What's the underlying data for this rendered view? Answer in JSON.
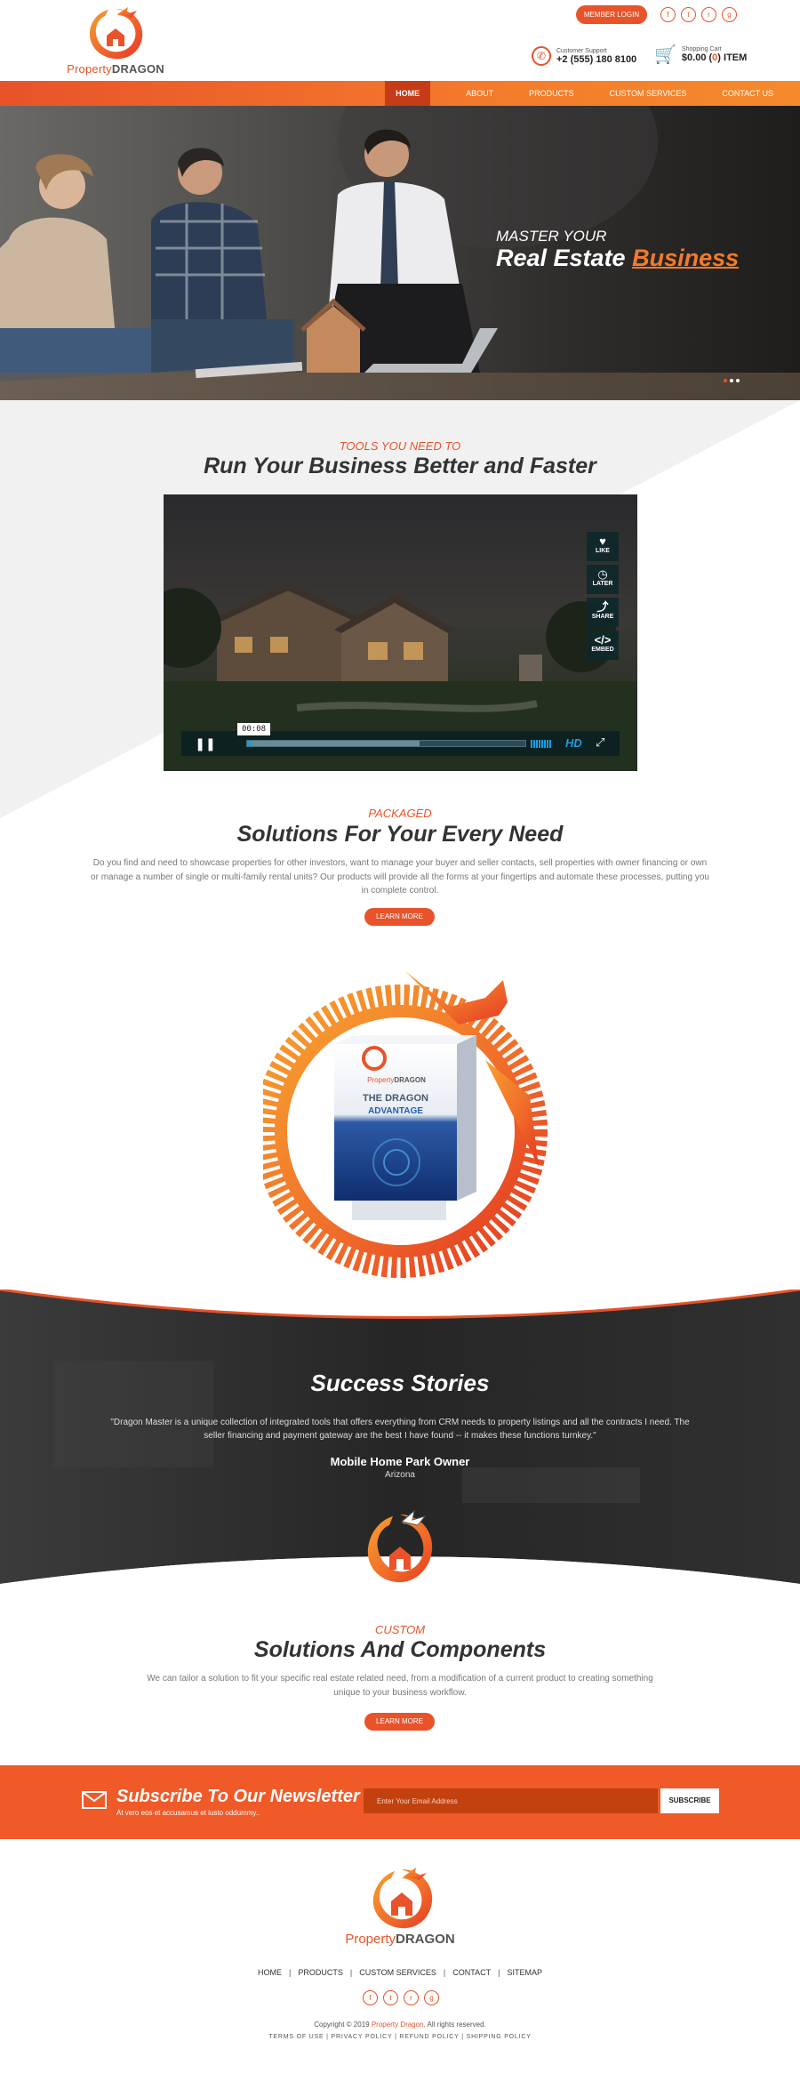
{
  "header": {
    "logo_text_a": "Property",
    "logo_text_b": "DRAGON",
    "member_login": "MEMBER LOGIN",
    "social": [
      "f",
      "t",
      "r",
      "g"
    ],
    "support_label": "Customer Support",
    "support_phone": "+2 (555) 180 8100",
    "cart_label": "Shopping Cart",
    "cart_amount": "$0.00",
    "cart_open": "(",
    "cart_count": "0",
    "cart_close": ")",
    "cart_unit": "ITEM"
  },
  "nav": {
    "items": [
      "HOME",
      "ABOUT",
      "PRODUCTS",
      "CUSTOM SERVICES",
      "CONTACT US"
    ]
  },
  "hero": {
    "line1": "MASTER YOUR",
    "line2_a": "Real Estate ",
    "line2_b": "Business"
  },
  "tools": {
    "kicker": "TOOLS YOU NEED TO",
    "title": "Run Your Business Better and Faster"
  },
  "video": {
    "actions": [
      "LIKE",
      "LATER",
      "SHARE",
      "EMBED"
    ],
    "time": "00:08",
    "hd": "HD",
    "progress_buffered": 0.62,
    "progress_played": 0.015
  },
  "packaged": {
    "kicker": "PACKAGED",
    "title": "Solutions For Your Every Need",
    "para": "Do you find and need to showcase properties for other investors, want to manage your buyer and seller contacts, sell properties with owner financing or own or manage a number of single or multi-family rental units? Our products will provide all the forms at your fingertips and automate these processes, putting you in complete control.",
    "button": "LEARN MORE",
    "box_logo_a": "Property",
    "box_logo_b": "DRAGON",
    "box_line1": "THE DRAGON",
    "box_line2": "ADVANTAGE"
  },
  "success": {
    "title": "Success Stories",
    "quote": "\"Dragon Master is a unique collection of integrated tools that offers everything from CRM needs to property listings and all the contracts I need. The seller financing and payment gateway are the best I have found -- it makes these functions turnkey.\"",
    "name": "Mobile Home Park Owner",
    "location": "Arizona"
  },
  "custom": {
    "kicker": "CUSTOM",
    "title": "Solutions And Components",
    "para": "We can tailor a solution to fit your specific real estate related need, from a modification of a current product to creating something unique to your business workflow.",
    "button": "LEARN MORE"
  },
  "newsletter": {
    "title": "Subscribe To Our Newsletter",
    "subtitle": "At vero eos et accusamus et iusto oddummy..",
    "placeholder": "Enter Your Email Address",
    "button": "SUBSCRIBE"
  },
  "footer": {
    "logo_text_a": "Property",
    "logo_text_b": "DRAGON",
    "nav": [
      "HOME",
      "PRODUCTS",
      "CUSTOM SERVICES",
      "CONTACT",
      "SITEMAP"
    ],
    "copyright_a": "Copyright © 2019 ",
    "copyright_brand": "Property Dragon",
    "copyright_b": ". All rights reserved.",
    "legal": "TERMS OF USE  |  PRIVACY POLICY  |  REFUND POLICY  |  SHIPPING POLICY"
  },
  "colors": {
    "accent": "#e8532a",
    "nav_active": "#c63c16",
    "video_blue": "#1e9be0"
  }
}
